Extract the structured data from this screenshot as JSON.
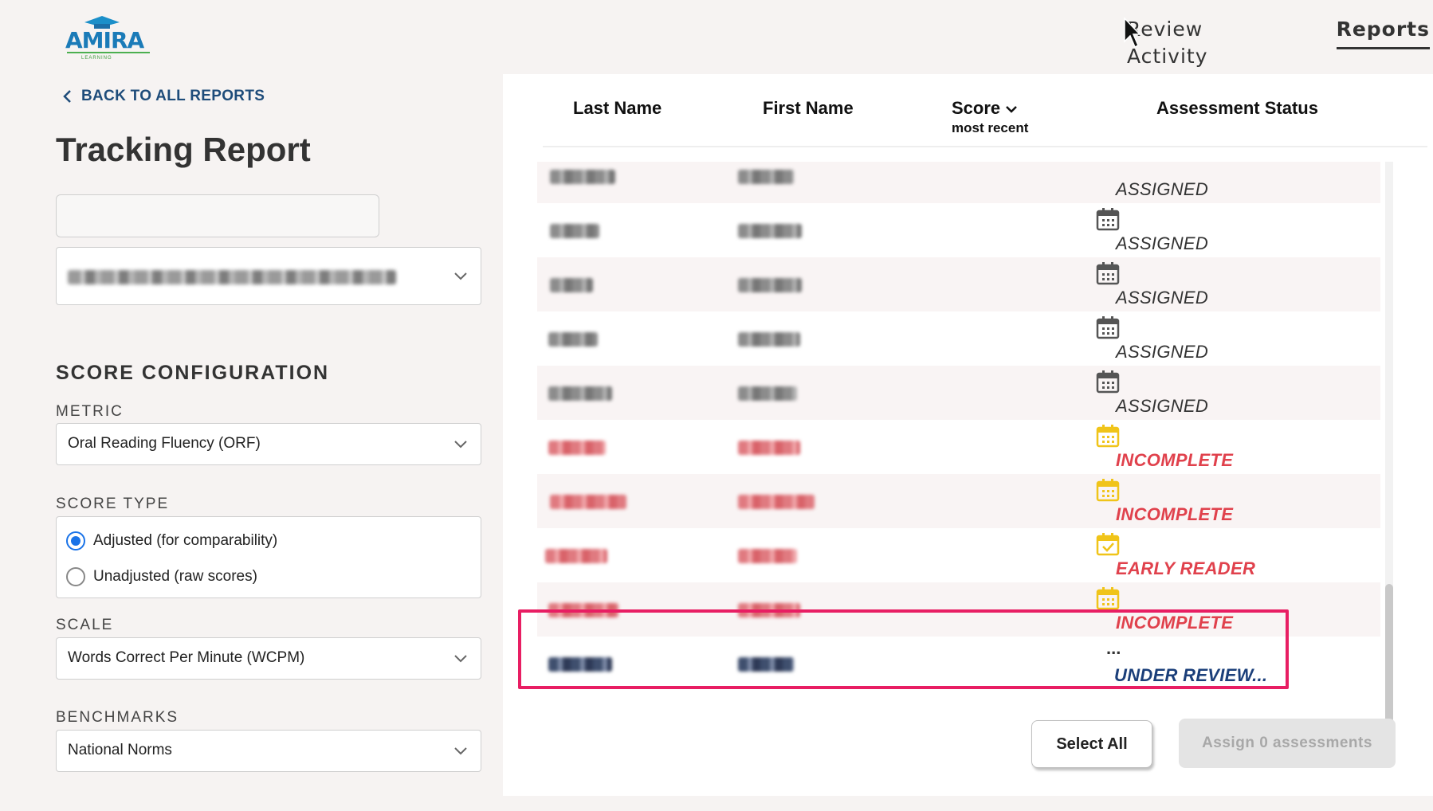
{
  "logo": {
    "brand": "AMIRA",
    "sub": "LEARNING"
  },
  "nav": {
    "review_activity": "Review Activity",
    "reports": "Reports"
  },
  "back_link": "BACK TO ALL REPORTS",
  "page_title": "Tracking Report",
  "score_config": {
    "title": "SCORE CONFIGURATION",
    "metric_label": "METRIC",
    "metric_value": "Oral Reading Fluency (ORF)",
    "score_type_label": "SCORE TYPE",
    "score_type_options": [
      "Adjusted (for comparability)",
      "Unadjusted (raw scores)"
    ],
    "score_type_selected": "Adjusted (for comparability)",
    "scale_label": "SCALE",
    "scale_value": "Words Correct Per Minute (WCPM)",
    "benchmarks_label": "BENCHMARKS",
    "benchmarks_value": "National Norms"
  },
  "table": {
    "headers": {
      "last_name": "Last Name",
      "first_name": "First Name",
      "score": "Score",
      "score_sub": "most recent",
      "status": "Assessment Status"
    },
    "rows": [
      {
        "status": "ASSIGNED",
        "icon": "calendar-icon",
        "color": "gray"
      },
      {
        "status": "ASSIGNED",
        "icon": "calendar-icon",
        "color": "gray"
      },
      {
        "status": "ASSIGNED",
        "icon": "calendar-icon",
        "color": "gray"
      },
      {
        "status": "ASSIGNED",
        "icon": "calendar-icon",
        "color": "gray"
      },
      {
        "status": "ASSIGNED",
        "icon": "calendar-icon",
        "color": "gray"
      },
      {
        "status": "INCOMPLETE",
        "icon": "calendar-warning-icon",
        "color": "red"
      },
      {
        "status": "INCOMPLETE",
        "icon": "calendar-warning-icon",
        "color": "red"
      },
      {
        "status": "EARLY READER",
        "icon": "calendar-check-icon",
        "color": "red"
      },
      {
        "status": "INCOMPLETE",
        "icon": "calendar-warning-icon",
        "color": "red"
      },
      {
        "status": "UNDER REVIEW...",
        "icon": "ellipsis-icon",
        "color": "navy",
        "dots": "..."
      }
    ]
  },
  "buttons": {
    "select_all": "Select All",
    "assign": "Assign 0 assessments"
  },
  "colors": {
    "brand_blue": "#1b7bb8",
    "accent_red": "#e0414c",
    "highlight": "#e81e63",
    "review_navy": "#1b3f7a",
    "calendar_yellow": "#f0c419"
  }
}
